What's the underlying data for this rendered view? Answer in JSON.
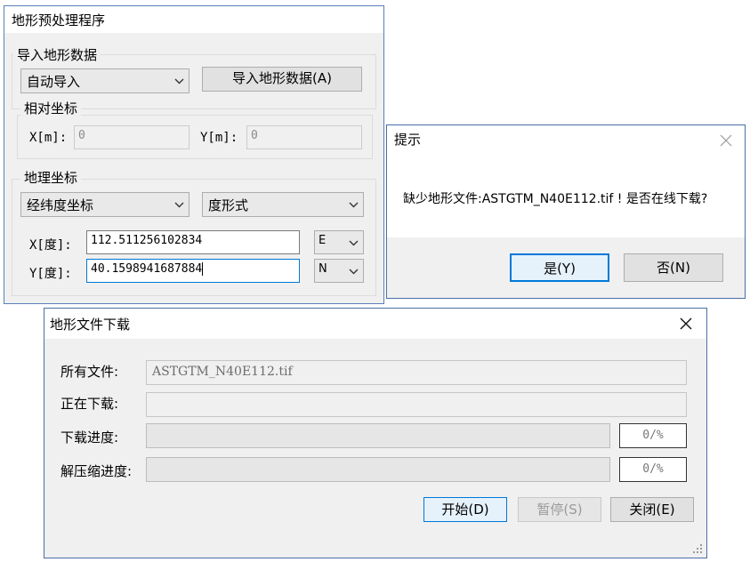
{
  "preprocess_window": {
    "title": "地形预处理程序",
    "import_group_label": "导入地形数据",
    "import_mode_value": "自动导入",
    "import_button_label": "导入地形数据(A)",
    "relative_group_label": "相对坐标",
    "x_label": "X[m]:",
    "x_value": "0",
    "y_label": "Y[m]:",
    "y_value": "0",
    "geo_group_label": "地理坐标",
    "coord_system_value": "经纬度坐标",
    "format_value": "度形式",
    "x_deg_label": "X[度]:",
    "x_deg_value": "112.511256102834",
    "x_hemisphere": "E",
    "y_deg_label": "Y[度]:",
    "y_deg_value": "40.1598941687884",
    "y_hemisphere": "N"
  },
  "prompt_dialog": {
    "title": "提示",
    "message": "缺少地形文件:ASTGTM_N40E112.tif ! 是否在线下载?",
    "yes_button": "是(Y)",
    "no_button": "否(N)"
  },
  "download_window": {
    "title": "地形文件下载",
    "all_files_label": "所有文件:",
    "all_files_value": "ASTGTM_N40E112.tif",
    "downloading_label": "正在下载:",
    "downloading_value": "",
    "download_progress_label": "下载进度:",
    "download_progress_text": "0/%",
    "download_progress": 0,
    "unzip_progress_label": "解压缩进度:",
    "unzip_progress_text": "0/%",
    "unzip_progress": 0,
    "start_button": "开始(D)",
    "pause_button": "暂停(S)",
    "close_button": "关闭(E)"
  },
  "colors": {
    "focus_border": "#0078d7",
    "window_border": "#4a6fa5",
    "dialog_bg": "#f0f0f0"
  }
}
